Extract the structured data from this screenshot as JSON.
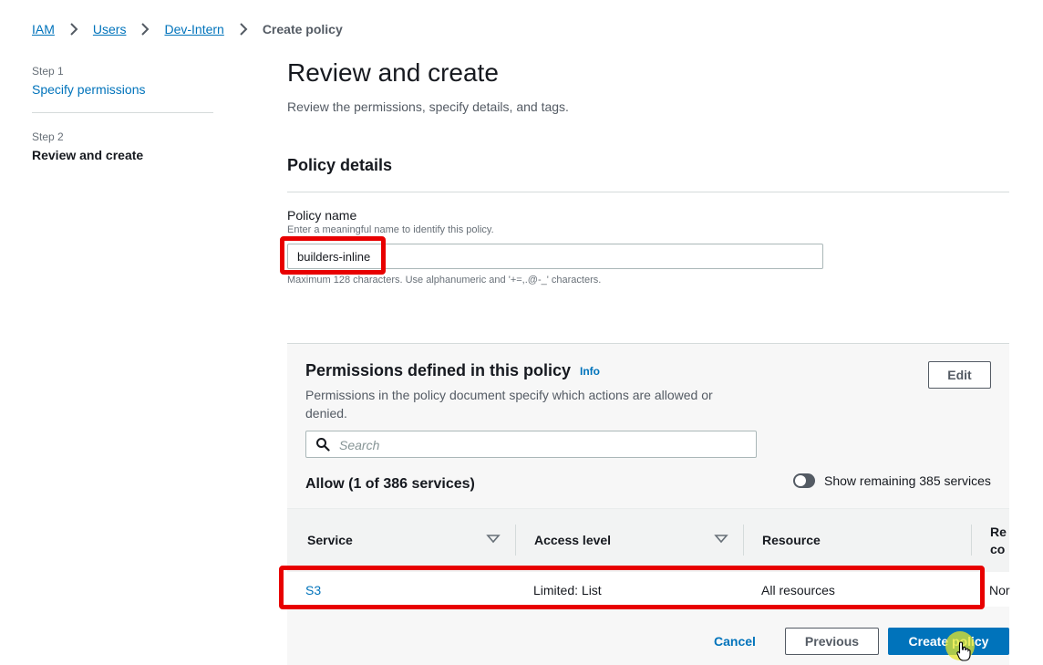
{
  "breadcrumb": {
    "items": [
      "IAM",
      "Users",
      "Dev-Intern"
    ],
    "current": "Create policy"
  },
  "steps": [
    {
      "label": "Step 1",
      "title": "Specify permissions"
    },
    {
      "label": "Step 2",
      "title": "Review and create"
    }
  ],
  "page": {
    "title": "Review and create",
    "description": "Review the permissions, specify details, and tags."
  },
  "policy_details": {
    "title": "Policy details",
    "name_label": "Policy name",
    "name_description": "Enter a meaningful name to identify this policy.",
    "name_value": "builders-inline",
    "name_constraint": "Maximum 128 characters. Use alphanumeric and '+=,.@-_' characters."
  },
  "permissions": {
    "title": "Permissions defined in this policy",
    "info": "Info",
    "edit_label": "Edit",
    "description": "Permissions in the policy document specify which actions are allowed or denied.",
    "search_placeholder": "Search",
    "allow_title": "Allow (1 of 386 services)",
    "toggle_label": "Show remaining 385 services",
    "columns": [
      "Service",
      "Access level",
      "Resource",
      "Re",
      "co"
    ],
    "rows": [
      {
        "service": "S3",
        "access_level": "Limited: List",
        "resource": "All resources",
        "conditions": "Nor"
      }
    ]
  },
  "footer": {
    "cancel_label": "Cancel",
    "previous_label": "Previous",
    "create_label": "Create policy"
  },
  "colors": {
    "link": "#0073bb",
    "primary_button": "#0073bb",
    "highlight": "#e80000"
  },
  "icons": [
    "chevron-right-icon",
    "search-icon",
    "sort-down-icon",
    "toggle-switch",
    "hand-cursor-icon"
  ]
}
